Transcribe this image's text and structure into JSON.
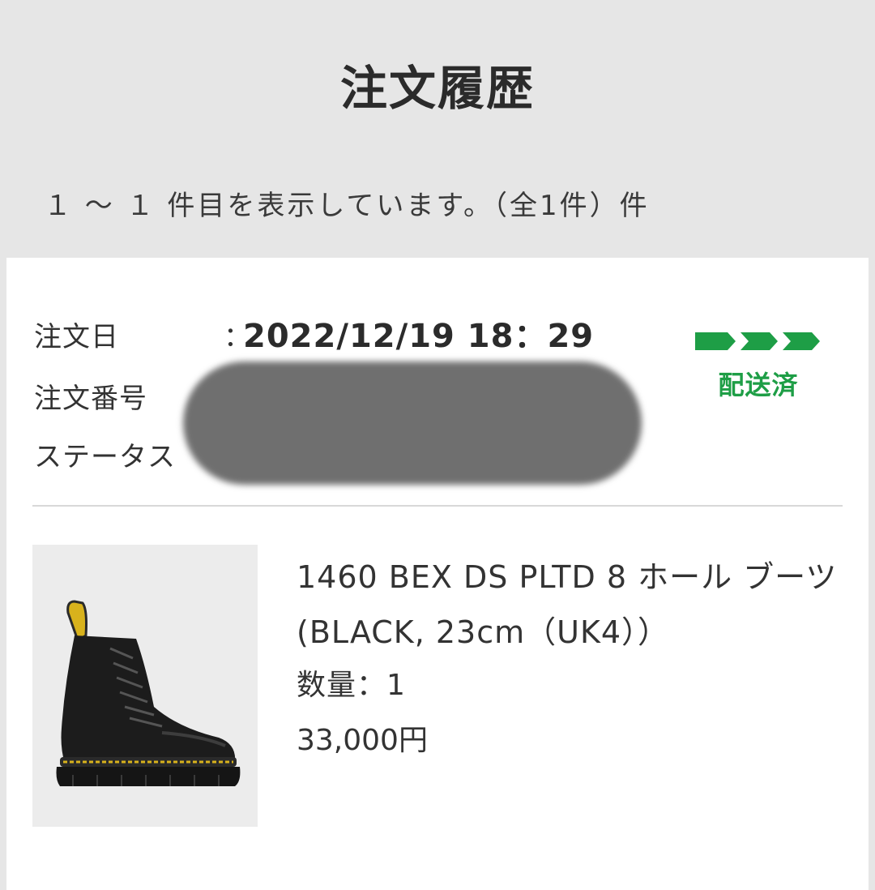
{
  "header": {
    "title": "注文履歴"
  },
  "results": {
    "count_text": "１ ～ １ 件目を表示しています。（全1件）件"
  },
  "order": {
    "date_label": "注文日",
    "separator": "：",
    "date_value": "2022/12/19 18：29",
    "number_label": "注文番号",
    "status_label": "ステータス",
    "status": {
      "text": "配送済",
      "color": "#1e9e46",
      "icon": "progress-arrows-icon",
      "steps_completed": 3,
      "steps_total": 3
    }
  },
  "product": {
    "image_icon": "boot-photo",
    "name": "1460 BEX DS PLTD 8 ホール ブーツ(BLACK, 23cm（UK4））",
    "quantity_text": "数量：1",
    "price_text": "33,000円"
  }
}
